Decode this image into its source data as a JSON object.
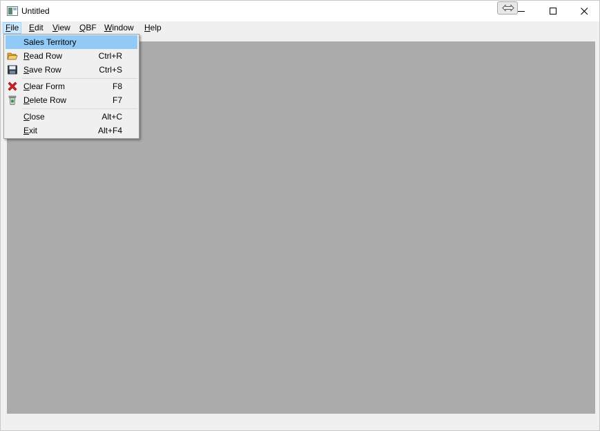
{
  "window": {
    "title": "Untitled"
  },
  "menubar": {
    "items": [
      {
        "mnemonic": "F",
        "rest": "ile"
      },
      {
        "mnemonic": "E",
        "rest": "dit"
      },
      {
        "mnemonic": "V",
        "rest": "iew"
      },
      {
        "mnemonic": "Q",
        "rest": "BF"
      },
      {
        "mnemonic": "W",
        "rest": "indow"
      },
      {
        "mnemonic": "H",
        "rest": "elp"
      }
    ]
  },
  "file_menu": {
    "items": [
      {
        "label": "Sales Territory",
        "highlighted": true
      },
      {
        "mnemonic": "R",
        "rest": "ead Row",
        "shortcut": "Ctrl+R",
        "icon": "folder-open-icon"
      },
      {
        "mnemonic": "S",
        "rest": "ave Row",
        "shortcut": "Ctrl+S",
        "icon": "floppy-disk-icon"
      },
      {
        "mnemonic": "C",
        "rest": "lear Form",
        "shortcut": "F8",
        "icon": "red-x-icon"
      },
      {
        "mnemonic": "D",
        "rest": "elete Row",
        "shortcut": "F7",
        "icon": "trash-can-icon"
      },
      {
        "mnemonic": "C",
        "rest": "lose",
        "shortcut": "Alt+C"
      },
      {
        "mnemonic": "E",
        "rest": "xit",
        "shortcut": "Alt+F4"
      }
    ]
  },
  "colors": {
    "highlight": "#91c9f7",
    "mdi_background": "#ababab",
    "menu_active": "#cce8ff"
  }
}
